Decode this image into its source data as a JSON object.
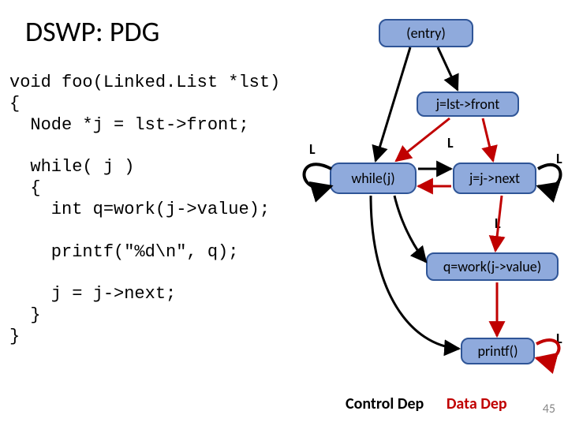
{
  "title": "DSWP: PDG",
  "code": "void foo(Linked.List *lst)\n{\n  Node *j = lst->front;\n\n  while( j )\n  {\n    int q=work(j->value);\n\n    printf(\"%d\\n\", q);\n\n    j = j->next;\n  }\n}",
  "nodes": {
    "entry": "(entry)",
    "init": "j=lst->front",
    "while": "while(j)",
    "next": "j=j->next",
    "work": "q=work(j->value)",
    "printf": "printf()"
  },
  "labels": {
    "L1": "L",
    "L2": "L",
    "L3": "L",
    "L4": "L",
    "L5": "L"
  },
  "legend": {
    "control": "Control Dep",
    "data": "Data Dep"
  },
  "page": "45"
}
